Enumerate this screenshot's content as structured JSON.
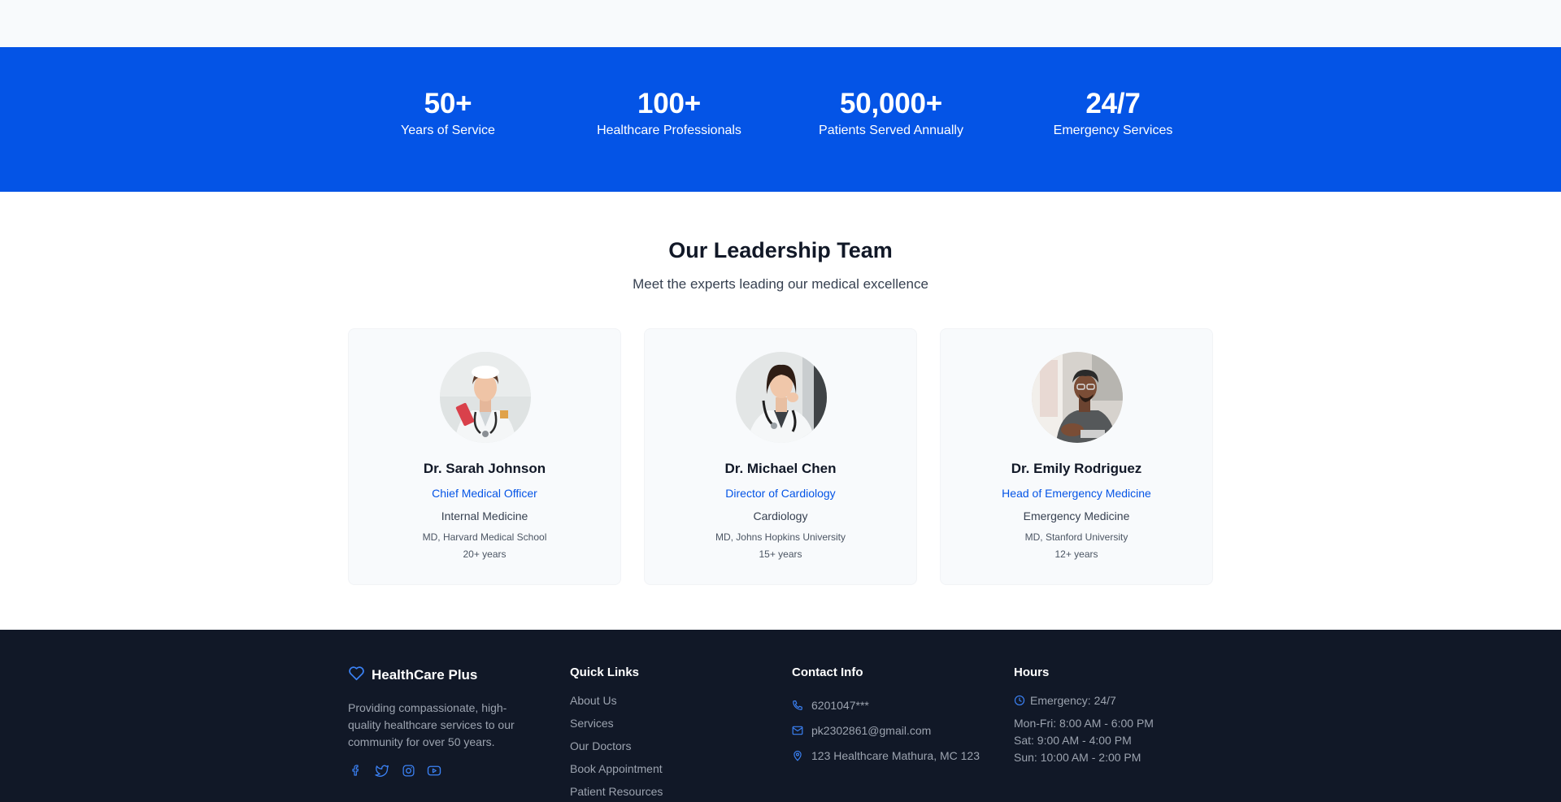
{
  "stats": [
    {
      "value": "50+",
      "label": "Years of Service"
    },
    {
      "value": "100+",
      "label": "Healthcare Professionals"
    },
    {
      "value": "50,000+",
      "label": "Patients Served Annually"
    },
    {
      "value": "24/7",
      "label": "Emergency Services"
    }
  ],
  "team": {
    "title": "Our Leadership Team",
    "subtitle": "Meet the experts leading our medical excellence",
    "members": [
      {
        "name": "Dr. Sarah Johnson",
        "role": "Chief Medical Officer",
        "specialty": "Internal Medicine",
        "education": "MD, Harvard Medical School",
        "experience": "20+ years"
      },
      {
        "name": "Dr. Michael Chen",
        "role": "Director of Cardiology",
        "specialty": "Cardiology",
        "education": "MD, Johns Hopkins University",
        "experience": "15+ years"
      },
      {
        "name": "Dr. Emily Rodriguez",
        "role": "Head of Emergency Medicine",
        "specialty": "Emergency Medicine",
        "education": "MD, Stanford University",
        "experience": "12+ years"
      }
    ]
  },
  "footer": {
    "brand": {
      "name": "HealthCare Plus",
      "icon": "heart-icon",
      "description": "Providing compassionate, high-quality healthcare services to our community for over 50 years."
    },
    "socials": [
      "facebook-icon",
      "twitter-icon",
      "instagram-icon",
      "youtube-icon"
    ],
    "quick_links": {
      "title": "Quick Links",
      "items": [
        "About Us",
        "Services",
        "Our Doctors",
        "Book Appointment",
        "Patient Resources"
      ]
    },
    "contact": {
      "title": "Contact Info",
      "phone": "6201047***",
      "email": "pk2302861@gmail.com",
      "address": "123 Healthcare Mathura, MC 123"
    },
    "hours": {
      "title": "Hours",
      "emergency": "Emergency: 24/7",
      "weekdays": "Mon-Fri: 8:00 AM - 6:00 PM",
      "saturday": "Sat: 9:00 AM - 4:00 PM",
      "sunday": "Sun: 10:00 AM - 2:00 PM"
    }
  },
  "colors": {
    "primary": "#0454e6",
    "footer_bg": "#111827",
    "card_bg": "#f8fafc"
  }
}
